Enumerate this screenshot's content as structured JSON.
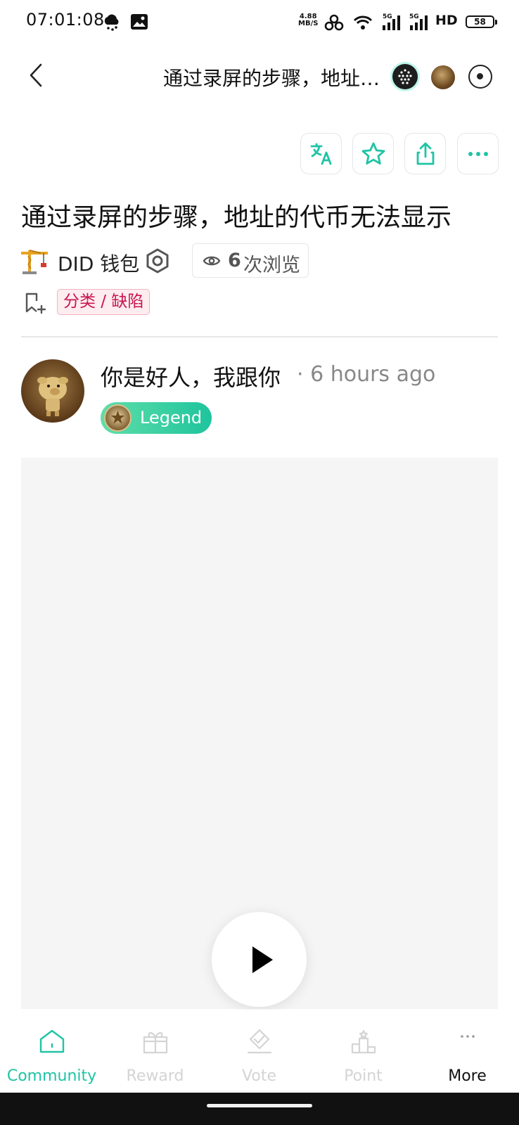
{
  "status_bar": {
    "time": "07:01:08",
    "net_speed_value": "4.88",
    "net_speed_unit": "MB/S",
    "sim1_label": "5G",
    "sim2_label": "5G",
    "hd_label": "HD",
    "battery_level": "58"
  },
  "header": {
    "title": "通过录屏的步骤，地址的代币无法显示"
  },
  "post": {
    "title": "通过录屏的步骤，地址的代币无法显示",
    "community_name": "DID 钱包",
    "views_count": "6",
    "views_label": "次浏览",
    "category_tag": "分类 / 缺陷"
  },
  "author": {
    "name": "你是好人，我跟你",
    "time": "· 6 hours ago",
    "badge": "Legend"
  },
  "tabs": [
    {
      "label": "Community",
      "icon": "home-icon",
      "state": "active"
    },
    {
      "label": "Reward",
      "icon": "gift-icon",
      "state": "disabled"
    },
    {
      "label": "Vote",
      "icon": "vote-icon",
      "state": "disabled"
    },
    {
      "label": "Point",
      "icon": "podium-icon",
      "state": "disabled"
    },
    {
      "label": "More",
      "icon": "more-dots-icon",
      "state": "normal"
    }
  ],
  "colors": {
    "accent": "#1fc4a5",
    "tag_text": "#c8174e",
    "tag_bg": "#fdecf0",
    "disabled": "#d4d4d4",
    "video_bg": "#f5f5f5"
  }
}
